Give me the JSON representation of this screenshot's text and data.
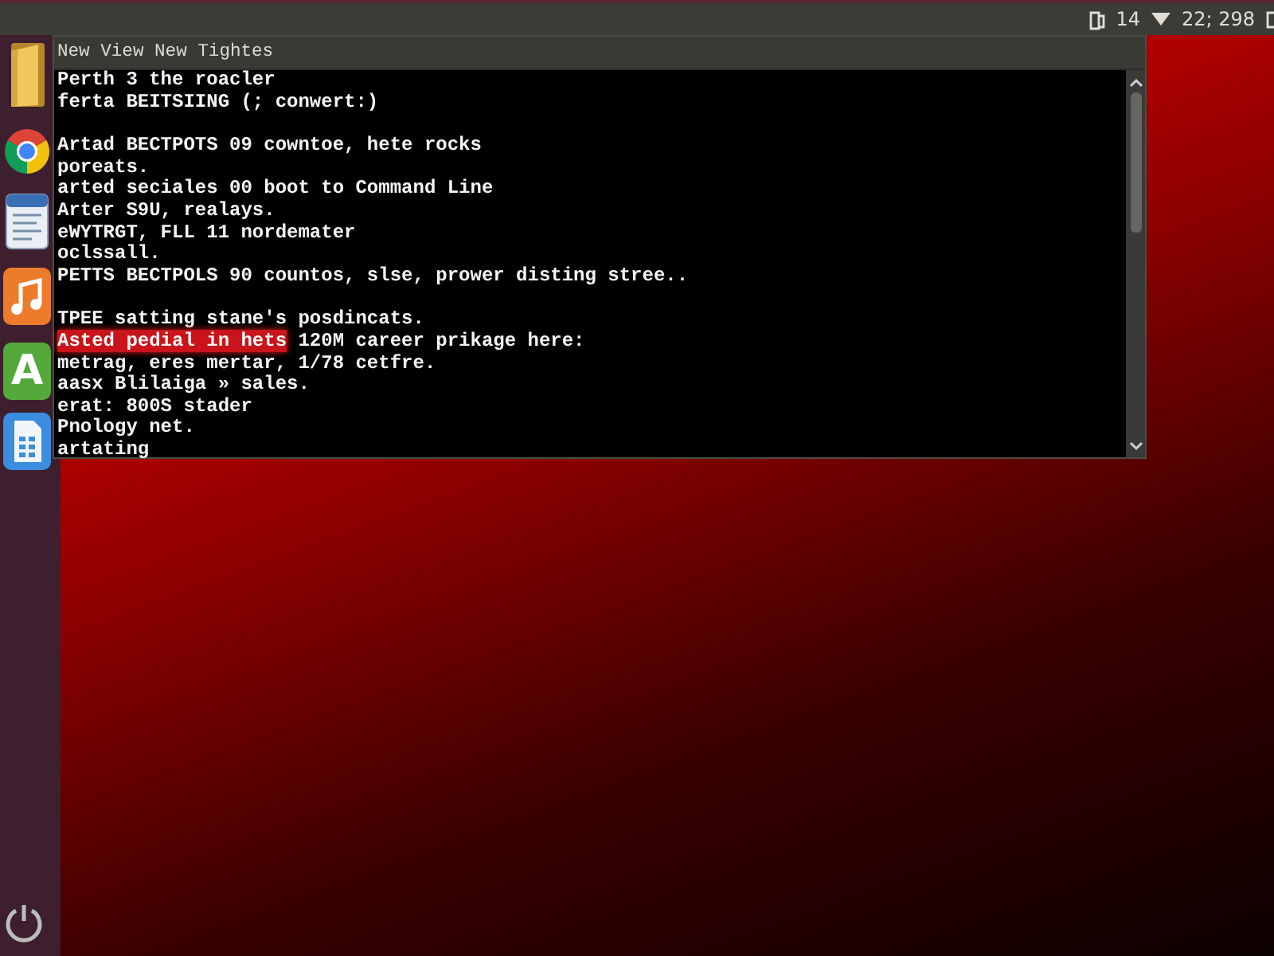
{
  "top_panel": {
    "indicator": "14",
    "clock": "22; 298"
  },
  "launcher": {
    "items": [
      {
        "kind": "folder"
      },
      {
        "kind": "browser"
      },
      {
        "kind": "editor"
      },
      {
        "kind": "music"
      },
      {
        "kind": "store",
        "glyph": "A"
      },
      {
        "kind": "office"
      }
    ]
  },
  "terminal": {
    "title": "New View New Tightes",
    "blocks": [
      {
        "lines": [
          {
            "text": "Perth 3 the roacler"
          },
          {
            "text": "ferta BEITSIING (; conwert:)"
          }
        ]
      },
      {
        "lines": [
          {
            "text": "Artad BECTPOTS 09 cowntoe, hete rocks"
          },
          {
            "text": "poreats."
          },
          {
            "text": "arted seciales 00 boot to Command Line"
          },
          {
            "text": "Arter S9U, realays."
          },
          {
            "text": "eWYTRGT, FLL 11 nordemater"
          },
          {
            "text": "oclssall."
          },
          {
            "text": "PETTS BECTPOLS 90 countos, slse, prower disting stree.."
          }
        ]
      },
      {
        "lines": [
          {
            "text": "TPEE satting stane's posdincats."
          },
          {
            "segments": [
              {
                "text": "Asted pedial in hets",
                "selected": true
              },
              {
                "text": " 120M career prikage here:",
                "selected": false
              }
            ]
          },
          {
            "text": "metrag, eres mertar, 1/78 cetfre."
          },
          {
            "text": "aasx Blilaiga » sales."
          },
          {
            "text": "erat: 800S stader"
          },
          {
            "text": "Pnology net."
          },
          {
            "text": "artating"
          }
        ]
      }
    ]
  }
}
